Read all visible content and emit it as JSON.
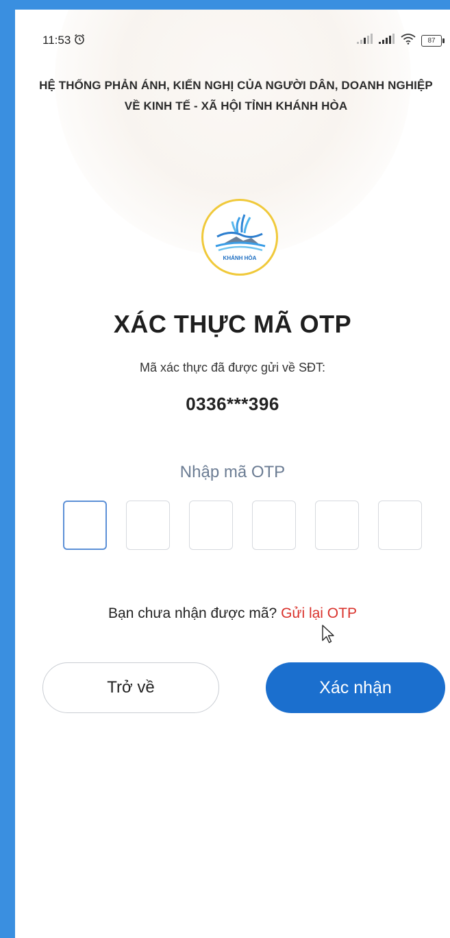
{
  "status_bar": {
    "time": "11:53",
    "alarm_icon": "alarm-clock-icon",
    "signal_icons": [
      "signal-weak-icon",
      "signal-strong-icon"
    ],
    "wifi_icon": "wifi-icon",
    "battery": "87"
  },
  "header": {
    "title_line1": "HỆ THỐNG PHẢN ÁNH, KIẾN NGHỊ CỦA NGƯỜI DÂN, DOANH NGHIỆP",
    "title_line2": "VỀ KINH TẾ - XÃ HỘI TỈNH KHÁNH HÒA"
  },
  "logo": {
    "text": "KHÁNH HÒA"
  },
  "main": {
    "title": "XÁC THỰC MÃ OTP",
    "subtitle": "Mã xác thực đã được gửi về SĐT:",
    "phone": "0336***396",
    "otp_label": "Nhập mã OTP",
    "otp_digits": [
      "",
      "",
      "",
      "",
      "",
      ""
    ],
    "resend_prompt": "Bạn chưa nhận được mã?",
    "resend_link": "Gửi lại OTP"
  },
  "buttons": {
    "back": "Trở về",
    "confirm": "Xác nhận"
  },
  "colors": {
    "accent": "#1b6fce",
    "frame": "#3a8fe0",
    "link": "#d9312b",
    "logo_ring": "#f0c93a"
  }
}
